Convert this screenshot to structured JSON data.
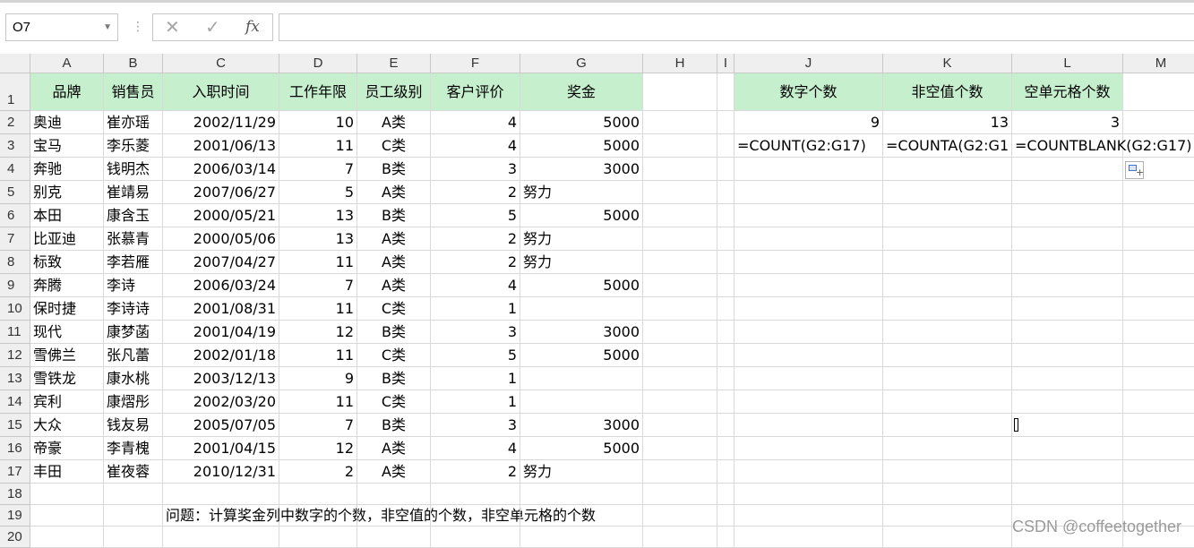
{
  "formula_bar": {
    "name_box": "O7",
    "cancel_icon": "✕",
    "enter_icon": "✓",
    "fx_label": "fx",
    "formula": ""
  },
  "columns": [
    {
      "letter": "A"
    },
    {
      "letter": "B"
    },
    {
      "letter": "C"
    },
    {
      "letter": "D"
    },
    {
      "letter": "E"
    },
    {
      "letter": "F"
    },
    {
      "letter": "G"
    },
    {
      "letter": "H"
    },
    {
      "letter": "I"
    },
    {
      "letter": "J"
    },
    {
      "letter": "K"
    },
    {
      "letter": "L"
    },
    {
      "letter": "M"
    }
  ],
  "row_numbers": [
    "1",
    "2",
    "3",
    "4",
    "5",
    "6",
    "7",
    "8",
    "9",
    "10",
    "11",
    "12",
    "13",
    "14",
    "15",
    "16",
    "17",
    "18",
    "19",
    "20"
  ],
  "header_row": {
    "A": "品牌",
    "B": "销售员",
    "C": "入职时间",
    "D": "工作年限",
    "E": "员工级别",
    "F": "客户评价",
    "G": "奖金",
    "J": "数字个数",
    "K": "非空值个数",
    "L": "空单元格个数"
  },
  "rows": [
    [
      "奥迪",
      "崔亦瑶",
      "2002/11/29",
      "10",
      "A类",
      "4",
      "5000"
    ],
    [
      "宝马",
      "李乐菱",
      "2001/06/13",
      "11",
      "C类",
      "4",
      "5000"
    ],
    [
      "奔驰",
      "钱明杰",
      "2006/03/14",
      "7",
      "B类",
      "3",
      "3000"
    ],
    [
      "别克",
      "崔靖易",
      "2007/06/27",
      "5",
      "A类",
      "2",
      "努力"
    ],
    [
      "本田",
      "康含玉",
      "2000/05/21",
      "13",
      "B类",
      "5",
      "5000"
    ],
    [
      "比亚迪",
      "张慕青",
      "2000/05/06",
      "13",
      "A类",
      "2",
      "努力"
    ],
    [
      "标致",
      "李若雁",
      "2007/04/27",
      "11",
      "A类",
      "2",
      "努力"
    ],
    [
      "奔腾",
      "李诗",
      "2006/03/24",
      "7",
      "A类",
      "4",
      "5000"
    ],
    [
      "保时捷",
      "李诗诗",
      "2001/08/31",
      "11",
      "C类",
      "1",
      ""
    ],
    [
      "现代",
      "康梦菡",
      "2001/04/19",
      "12",
      "B类",
      "3",
      "3000"
    ],
    [
      "雪佛兰",
      "张凡蕾",
      "2002/01/18",
      "11",
      "C类",
      "5",
      "5000"
    ],
    [
      "雪铁龙",
      "康水桃",
      "2003/12/13",
      "9",
      "B类",
      "1",
      ""
    ],
    [
      "宾利",
      "康熠彤",
      "2002/03/20",
      "11",
      "C类",
      "1",
      ""
    ],
    [
      "大众",
      "钱友易",
      "2005/07/05",
      "7",
      "B类",
      "3",
      "3000"
    ],
    [
      "帝豪",
      "李青槐",
      "2001/04/15",
      "12",
      "A类",
      "4",
      "5000"
    ],
    [
      "丰田",
      "崔夜蓉",
      "2010/12/31",
      "2",
      "A类",
      "2",
      "努力"
    ]
  ],
  "results": {
    "J2": "9",
    "K2": "13",
    "L2": "3",
    "J3": "=COUNT(G2:G17)",
    "K3": "=COUNTA(G2:G1",
    "L3": "=COUNTBLANK(G2:G17)"
  },
  "question": "问题：计算奖金列中数字的个数，非空值的个数，非空单元格的个数",
  "watermark": "CSDN @coffeetogether",
  "colors": {
    "header_fill": "#c6efce",
    "grid_line": "#d9d9d9",
    "header_bg": "#efefef"
  }
}
